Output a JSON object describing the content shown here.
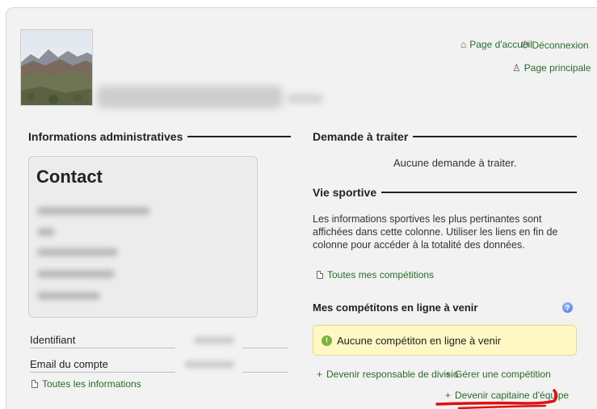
{
  "header": {
    "links": [
      {
        "label": "Page d'accueil",
        "icon": "home-icon"
      },
      {
        "label": "Déconnexion",
        "icon": "power-icon"
      },
      {
        "label": "Page principale",
        "icon": "user-icon"
      }
    ]
  },
  "admin": {
    "title": "Informations administratives",
    "contact_title": "Contact",
    "fields": [
      {
        "label": "Identifiant"
      },
      {
        "label": "Email du compte"
      }
    ],
    "all_info_link": "Toutes les informations"
  },
  "requests": {
    "title": "Demande à traiter",
    "empty": "Aucune demande à traiter."
  },
  "sport": {
    "title": "Vie sportive",
    "description": "Les informations sportives les plus pertinantes sont affichées dans cette colonne. Utiliser les liens en fin de colonne pour accéder à la totalité des données.",
    "all_competitions_link": "Toutes mes compétitions",
    "online_title": "Mes compétitons en ligne à venir",
    "notice": "Aucune compétiton en ligne à venir",
    "actions": [
      {
        "label": "Devenir responsable de divisio"
      },
      {
        "label": "Gérer une compétition"
      },
      {
        "label": "Devenir capitaine d'équipe"
      }
    ]
  },
  "colors": {
    "link": "#2a6b2a",
    "notice_bg": "#fff8c4",
    "annotation": "#e01010"
  }
}
